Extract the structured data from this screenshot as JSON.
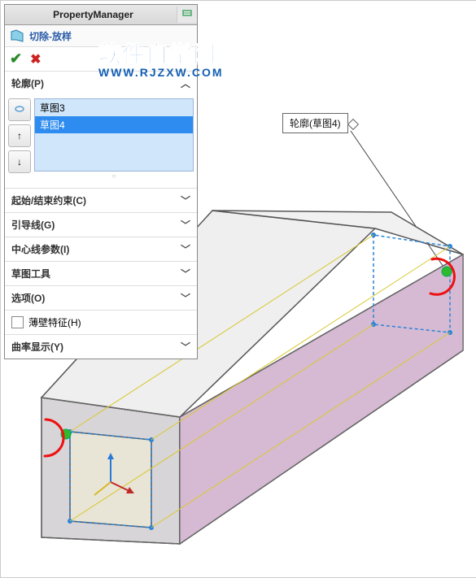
{
  "panel": {
    "title": "PropertyManager",
    "featureName": "切除-放样",
    "okTooltip": "OK",
    "cancelTooltip": "Cancel"
  },
  "profiles": {
    "headerLabel": "轮廓(P)",
    "items": [
      "草图3",
      "草图4"
    ],
    "selectedIndex": 1
  },
  "sections": {
    "startEnd": "起始/结束约束(C)",
    "guides": "引导线(G)",
    "centerline": "中心线参数(I)",
    "sketchTools": "草图工具",
    "options": "选项(O)",
    "thinFeature": "薄壁特征(H)",
    "curvature": "曲率显示(Y)"
  },
  "callout": {
    "label": "轮廓(草图4)"
  },
  "watermark": {
    "cn": "软件自学网",
    "url": "WWW.RJZXW.COM"
  }
}
